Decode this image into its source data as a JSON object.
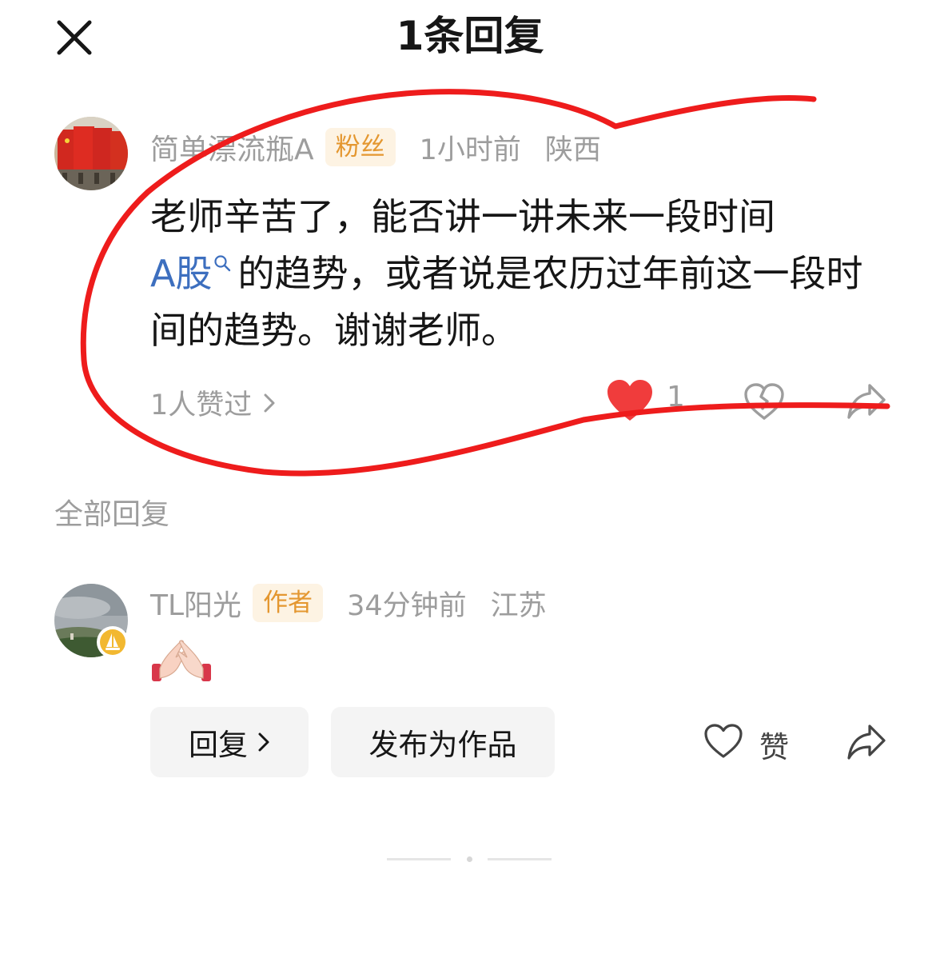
{
  "header": {
    "title": "1条回复",
    "close_icon": "close-icon"
  },
  "main_comment": {
    "username": "简单漂流瓶A",
    "badge": "粉丝",
    "time": "1小时前",
    "location": "陕西",
    "text_before_link": "老师辛苦了，能否讲一讲未来一段时间",
    "link_text": "A股",
    "text_after_link": "的趋势，或者说是农历过年前这一段时间的趋势。谢谢老师。",
    "likers_text": "1人赞过",
    "like_count": "1",
    "liked": true
  },
  "section": {
    "label": "全部回复"
  },
  "reply": {
    "username": "TL阳光",
    "badge": "作者",
    "time": "34分钟前",
    "location": "江苏",
    "emoji": "🙏🏻",
    "reply_button": "回复",
    "publish_button": "发布为作品",
    "like_label": "赞"
  },
  "colors": {
    "link": "#3d6fbf",
    "badge_text": "#e49730",
    "badge_bg": "#fdf3e3",
    "heart": "#f03c3c",
    "annotation": "#ee1c1c"
  }
}
